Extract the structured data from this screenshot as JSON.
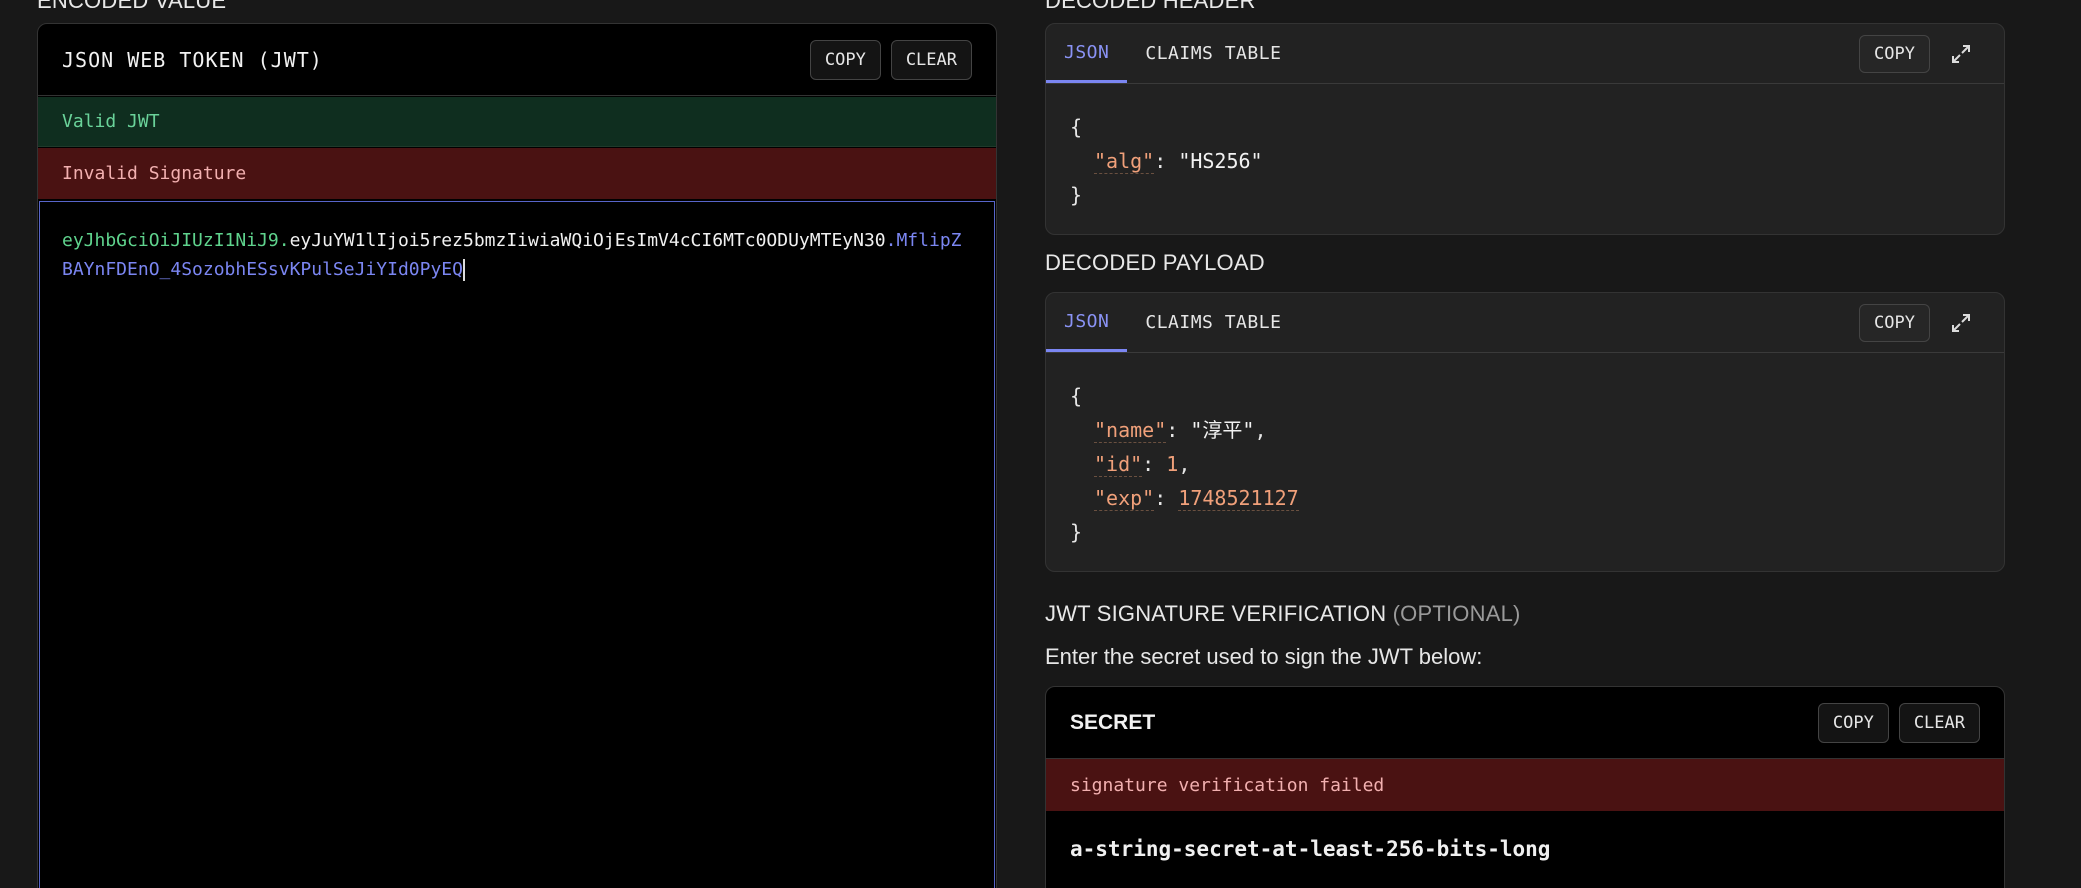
{
  "encoded_value": {
    "section_title": "ENCODED VALUE",
    "panel_title": "JSON WEB TOKEN (JWT)",
    "copy_label": "COPY",
    "clear_label": "CLEAR",
    "valid_status": "Valid JWT",
    "signature_status": "Invalid Signature",
    "token": {
      "header": "eyJhbGciOiJIUzI1NiJ9",
      "payload": "eyJuYW1lIjoi5rez5bmzIiwiaWQiOjEsImV4cCI6MTc0ODUyMTEyN30",
      "signature": "MflipZBAYnFDEnO_4SozobhESsvKPulSeJiYId0PyEQ",
      "dot": "."
    }
  },
  "decoded_header": {
    "section_title": "DECODED HEADER",
    "tab_json": "JSON",
    "tab_claims": "CLAIMS TABLE",
    "copy_label": "COPY",
    "open_brace": "{",
    "close_brace": "}",
    "alg_key": "\"alg\"",
    "alg_value": "\"HS256\""
  },
  "decoded_payload": {
    "section_title": "DECODED PAYLOAD",
    "tab_json": "JSON",
    "tab_claims": "CLAIMS TABLE",
    "copy_label": "COPY",
    "open_brace": "{",
    "close_brace": "}",
    "name_key": "\"name\"",
    "name_value": "\"淳平\"",
    "id_key": "\"id\"",
    "id_value": "1",
    "exp_key": "\"exp\"",
    "exp_value": "1748521127"
  },
  "verification": {
    "section_title": "JWT SIGNATURE VERIFICATION",
    "optional_label": "(OPTIONAL)",
    "hint": "Enter the secret used to sign the JWT below:",
    "panel_title": "SECRET",
    "copy_label": "COPY",
    "clear_label": "CLEAR",
    "error": "signature verification failed",
    "secret_value": "a-string-secret-at-least-256-bits-long"
  },
  "icons": {
    "expand": "expand-icon"
  },
  "colors": {
    "accent": "#7b86f2",
    "valid_bg": "#0f2e1f",
    "valid_text": "#6ad39a",
    "invalid_bg": "#4a1212",
    "invalid_text": "#f2b0b0",
    "json_key": "#f0a07a"
  }
}
